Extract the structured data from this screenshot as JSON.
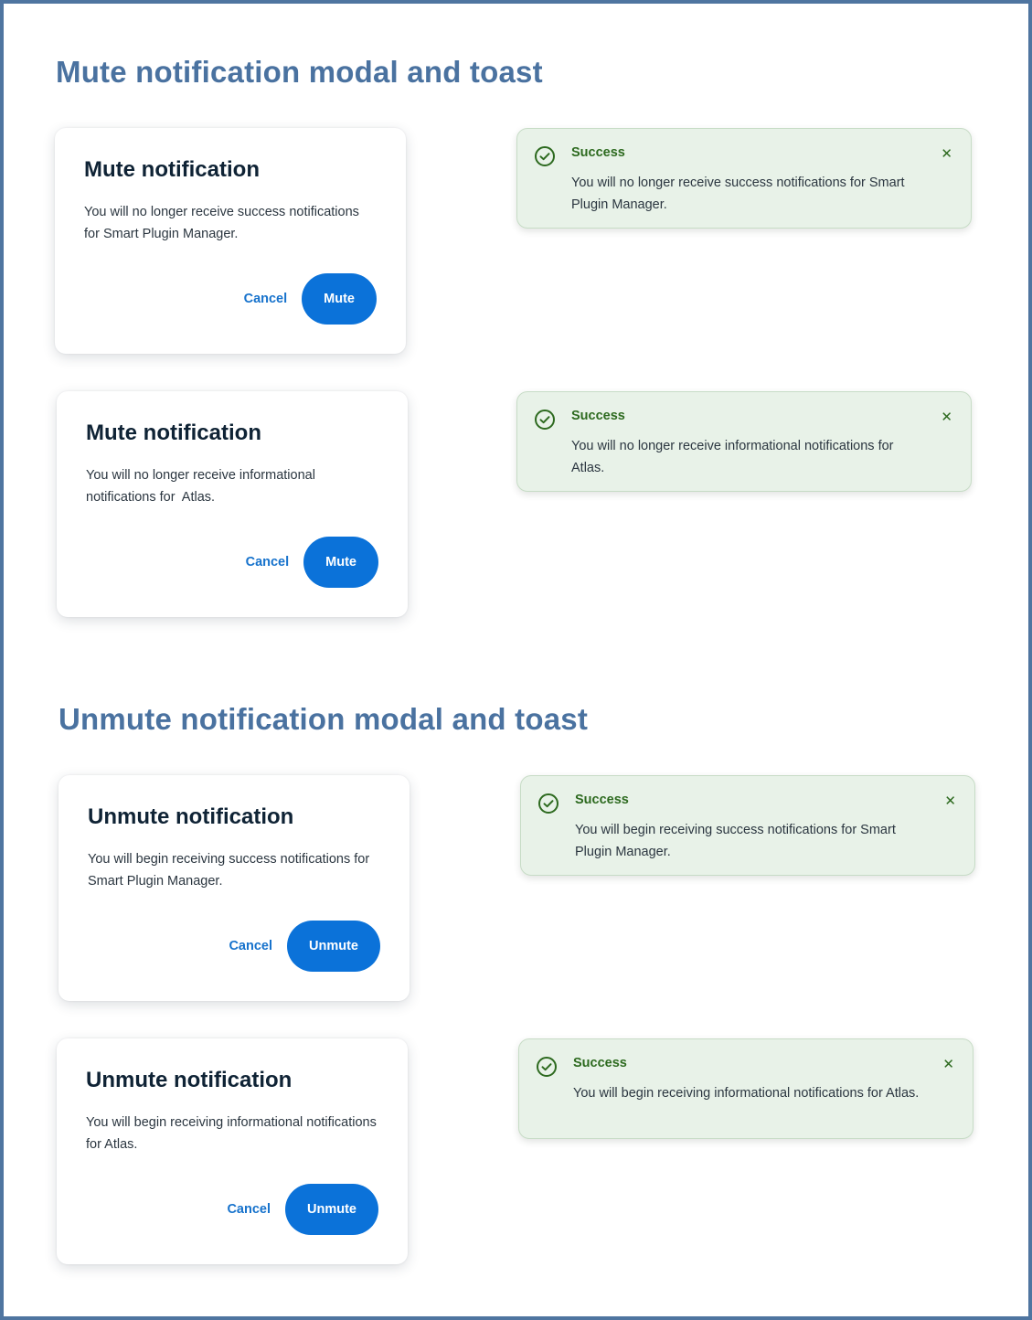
{
  "sections": [
    {
      "title": "Mute notification modal and toast"
    },
    {
      "title": "Unmute notification modal and toast"
    }
  ],
  "modals": [
    {
      "title": "Mute notification",
      "body": "You will no longer receive success notifications for Smart Plugin Manager.",
      "cancel": "Cancel",
      "confirm": "Mute"
    },
    {
      "title": "Mute notification",
      "body": "You will no longer receive informational notifications for  Atlas.",
      "cancel": "Cancel",
      "confirm": "Mute"
    },
    {
      "title": "Unmute notification",
      "body": "You will begin receiving success notifications for Smart Plugin Manager.",
      "cancel": "Cancel",
      "confirm": "Unmute"
    },
    {
      "title": "Unmute notification",
      "body": "You will begin receiving informational notifications for Atlas.",
      "cancel": "Cancel",
      "confirm": "Unmute"
    }
  ],
  "toasts": [
    {
      "title": "Success",
      "body": "You will no longer receive success notifications for Smart Plugin Manager.",
      "icon": "check-circle-icon",
      "close_icon": "close-icon"
    },
    {
      "title": "Success",
      "body": "You will no longer receive informational notifications for Atlas.",
      "icon": "check-circle-icon",
      "close_icon": "close-icon"
    },
    {
      "title": "Success",
      "body": "You will begin receiving success notifications for Smart Plugin Manager.",
      "icon": "check-circle-icon",
      "close_icon": "close-icon"
    },
    {
      "title": "Success",
      "body": "You will begin receiving informational notifications for Atlas.",
      "icon": "check-circle-icon",
      "close_icon": "close-icon"
    }
  ],
  "colors": {
    "heading": "#4a72a0",
    "primary_button": "#0b72d9",
    "toast_background": "#e8f2e8",
    "success_green": "#2d6a1f"
  }
}
